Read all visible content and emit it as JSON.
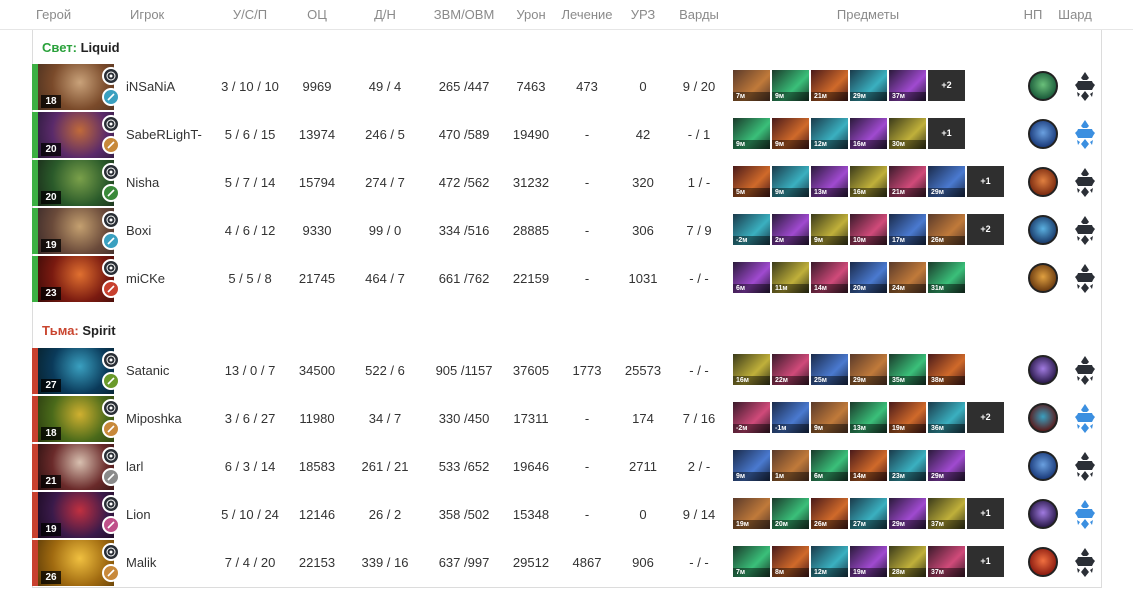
{
  "headers": {
    "hero": "Герой",
    "player": "Игрок",
    "kda": "У/С/П",
    "nw": "ОЦ",
    "lh_dn": "Д/Н",
    "gpm_xpm": "ЗВМ/ОВМ",
    "damage": "Урон",
    "heal": "Лечение",
    "tower": "УРЗ",
    "wards": "Варды",
    "items": "Предметы",
    "np": "НП",
    "shard": "Шард"
  },
  "teams": [
    {
      "side_label": "Свет:",
      "name": "Liquid",
      "players": [
        {
          "level": "18",
          "name": "iNSaNiA",
          "kda": "3 / 10 / 10",
          "nw": "9969",
          "lh_dn": "49 / 4",
          "gpm_xpm": "265 /447",
          "damage": "7463",
          "heal": "473",
          "tower": "0",
          "wards": "9 / 20",
          "items": [
            "7м",
            "9м",
            "21м",
            "29м",
            "37м"
          ],
          "more": "+2",
          "shard_active": false
        },
        {
          "level": "20",
          "name": "SabeRLighT-",
          "kda": "5 / 6 / 15",
          "nw": "13974",
          "lh_dn": "246 / 5",
          "gpm_xpm": "470 /589",
          "damage": "19490",
          "heal": "-",
          "tower": "42",
          "wards": "- / 1",
          "items": [
            "9м",
            "9м",
            "12м",
            "16м",
            "30м"
          ],
          "more": "+1",
          "shard_active": true
        },
        {
          "level": "20",
          "name": "Nisha",
          "kda": "5 / 7 / 14",
          "nw": "15794",
          "lh_dn": "274 / 7",
          "gpm_xpm": "472 /562",
          "damage": "31232",
          "heal": "-",
          "tower": "320",
          "wards": "1 / -",
          "items": [
            "5м",
            "9м",
            "13м",
            "16м",
            "21м",
            "29м"
          ],
          "more": "+1",
          "shard_active": false
        },
        {
          "level": "19",
          "name": "Boxi",
          "kda": "4 / 6 / 12",
          "nw": "9330",
          "lh_dn": "99 / 0",
          "gpm_xpm": "334 /516",
          "damage": "28885",
          "heal": "-",
          "tower": "306",
          "wards": "7 / 9",
          "items": [
            "-2м",
            "2м",
            "9м",
            "10м",
            "17м",
            "26м"
          ],
          "more": "+2",
          "shard_active": false
        },
        {
          "level": "23",
          "name": "miCKe",
          "kda": "5 / 5 / 8",
          "nw": "21745",
          "lh_dn": "464 / 7",
          "gpm_xpm": "661 /762",
          "damage": "22159",
          "heal": "-",
          "tower": "1031",
          "wards": "- / -",
          "items": [
            "6м",
            "11м",
            "14м",
            "20м",
            "24м",
            "31м"
          ],
          "more": "",
          "shard_active": false
        }
      ]
    },
    {
      "side_label": "Тьма:",
      "name": "Spirit",
      "players": [
        {
          "level": "27",
          "name": "Satanic",
          "kda": "13 / 0 / 7",
          "nw": "34500",
          "lh_dn": "522 / 6",
          "gpm_xpm": "905 /1157",
          "damage": "37605",
          "heal": "1773",
          "tower": "25573",
          "wards": "- / -",
          "items": [
            "16м",
            "22м",
            "25м",
            "29м",
            "35м",
            "38м"
          ],
          "more": "",
          "shard_active": false
        },
        {
          "level": "18",
          "name": "Miposhka",
          "kda": "3 / 6 / 27",
          "nw": "11980",
          "lh_dn": "34 / 7",
          "gpm_xpm": "330 /450",
          "damage": "17311",
          "heal": "-",
          "tower": "174",
          "wards": "7 / 16",
          "items": [
            "-2м",
            "-1м",
            "9м",
            "13м",
            "19м",
            "36м"
          ],
          "more": "+2",
          "shard_active": true
        },
        {
          "level": "21",
          "name": "larl",
          "kda": "6 / 3 / 14",
          "nw": "18583",
          "lh_dn": "261 / 21",
          "gpm_xpm": "533 /652",
          "damage": "19646",
          "heal": "-",
          "tower": "2711",
          "wards": "2 / -",
          "items": [
            "9м",
            "1м",
            "6м",
            "14м",
            "23м",
            "29м"
          ],
          "more": "",
          "shard_active": false
        },
        {
          "level": "19",
          "name": "Lion",
          "kda": "5 / 10 / 24",
          "nw": "12146",
          "lh_dn": "26 / 2",
          "gpm_xpm": "358 /502",
          "damage": "15348",
          "heal": "-",
          "tower": "0",
          "wards": "9 / 14",
          "items": [
            "19м",
            "20м",
            "26м",
            "27м",
            "29м",
            "37м"
          ],
          "more": "+1",
          "shard_active": true
        },
        {
          "level": "26",
          "name": "Malik",
          "kda": "7 / 4 / 20",
          "nw": "22153",
          "lh_dn": "339 / 16",
          "gpm_xpm": "637 /997",
          "damage": "29512",
          "heal": "4867",
          "tower": "906",
          "wards": "- / -",
          "items": [
            "7м",
            "8м",
            "12м",
            "19м",
            "28м",
            "37м"
          ],
          "more": "+1",
          "shard_active": false
        }
      ]
    }
  ],
  "colors": {
    "radiant": "#3cb043",
    "dire": "#c8402e",
    "shard_active": "#3b8fe0",
    "shard_inactive": "#2b2f36"
  }
}
